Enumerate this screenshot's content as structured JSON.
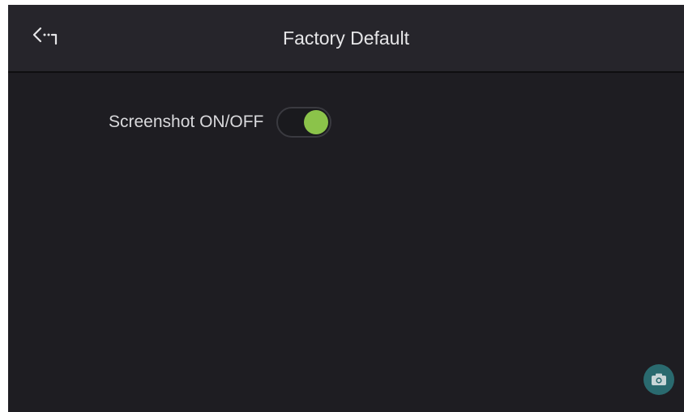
{
  "header": {
    "title": "Factory Default",
    "back_icon": "back-arrow-icon"
  },
  "settings": {
    "screenshot": {
      "label": "Screenshot ON/OFF",
      "state": "on",
      "on_color": "#8bc34a"
    }
  },
  "floating_button": {
    "icon": "camera-icon",
    "color": "#2a6a6f"
  }
}
